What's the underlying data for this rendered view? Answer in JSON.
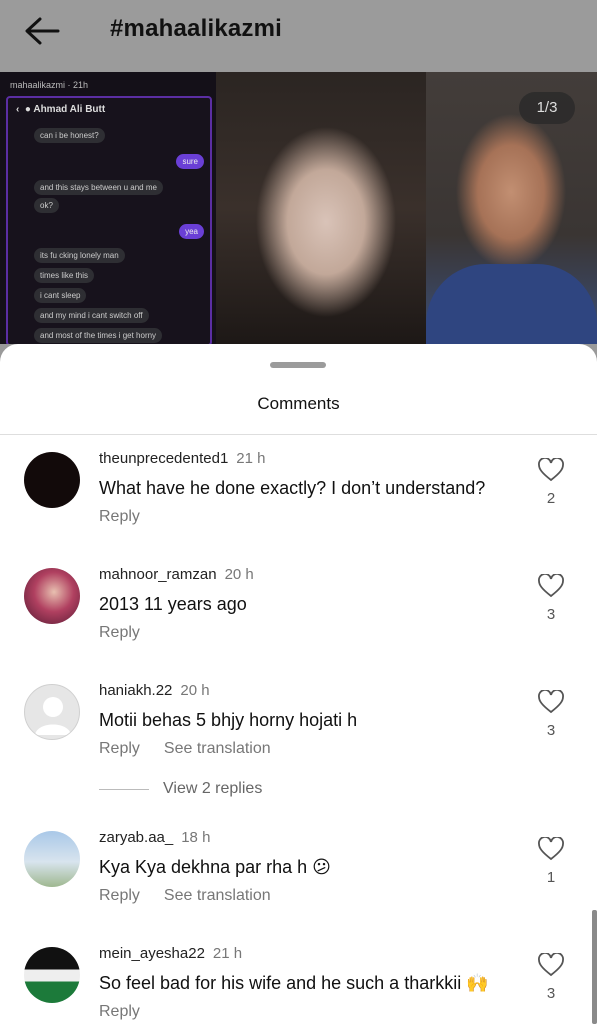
{
  "header": {
    "title": "#mahaalikazmi"
  },
  "post": {
    "counter": "1/3",
    "chat": {
      "user": "mahaalikazmi · 21h",
      "contact": "Ahmad Ali Butt",
      "messages": [
        {
          "dir": "in",
          "text": "can i be honest?"
        },
        {
          "dir": "out",
          "text": "sure"
        },
        {
          "dir": "in",
          "text": "and this stays between u and me"
        },
        {
          "dir": "in",
          "text": "ok?"
        },
        {
          "dir": "out",
          "text": "yea"
        },
        {
          "dir": "in",
          "text": "its fu cking lonely man"
        },
        {
          "dir": "in",
          "text": "times like this"
        },
        {
          "dir": "in",
          "text": "i cant sleep"
        },
        {
          "dir": "in",
          "text": "and my mind i cant switch off"
        },
        {
          "dir": "in",
          "text": "and most of the times i get horny"
        }
      ]
    }
  },
  "comments_sheet": {
    "title": "Comments",
    "reply_label": "Reply",
    "see_translation_label": "See translation",
    "view_replies_label": "View 2 replies",
    "comments": [
      {
        "username": "theunprecedented1",
        "time": "21 h",
        "text": "What have he done exactly? I don’t understand?",
        "likes": "2",
        "translation": false
      },
      {
        "username": "mahnoor_ramzan",
        "time": "20 h",
        "text": "2013 11 years ago",
        "likes": "3",
        "translation": false
      },
      {
        "username": "haniakh.22",
        "time": "20 h",
        "text": "Motii behas 5 bhjy horny hojati h",
        "likes": "3",
        "translation": true
      },
      {
        "username": "zaryab.aa_",
        "time": "18 h",
        "text": "Kya Kya dekhna par rha h 😕",
        "likes": "1",
        "translation": true
      },
      {
        "username": "mein_ayesha22",
        "time": "21 h",
        "text": "So feel bad for his wife and he such a tharkkii 🙌",
        "likes": "3",
        "translation": false
      }
    ]
  },
  "colors": {
    "overlay": "#9b9b9b",
    "chat_accent": "#6a3fd6",
    "secondary_text": "#777777"
  }
}
